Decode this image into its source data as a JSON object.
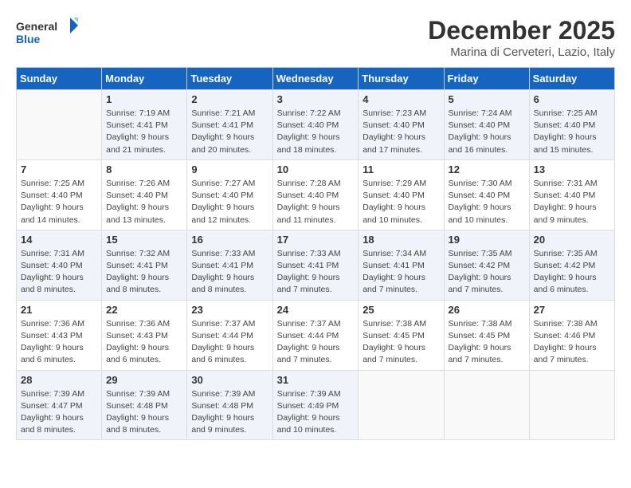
{
  "logo": {
    "text_general": "General",
    "text_blue": "Blue"
  },
  "title": {
    "month": "December 2025",
    "location": "Marina di Cerveteri, Lazio, Italy"
  },
  "days_of_week": [
    "Sunday",
    "Monday",
    "Tuesday",
    "Wednesday",
    "Thursday",
    "Friday",
    "Saturday"
  ],
  "weeks": [
    [
      {
        "day": "",
        "info": ""
      },
      {
        "day": "1",
        "info": "Sunrise: 7:19 AM\nSunset: 4:41 PM\nDaylight: 9 hours\nand 21 minutes."
      },
      {
        "day": "2",
        "info": "Sunrise: 7:21 AM\nSunset: 4:41 PM\nDaylight: 9 hours\nand 20 minutes."
      },
      {
        "day": "3",
        "info": "Sunrise: 7:22 AM\nSunset: 4:40 PM\nDaylight: 9 hours\nand 18 minutes."
      },
      {
        "day": "4",
        "info": "Sunrise: 7:23 AM\nSunset: 4:40 PM\nDaylight: 9 hours\nand 17 minutes."
      },
      {
        "day": "5",
        "info": "Sunrise: 7:24 AM\nSunset: 4:40 PM\nDaylight: 9 hours\nand 16 minutes."
      },
      {
        "day": "6",
        "info": "Sunrise: 7:25 AM\nSunset: 4:40 PM\nDaylight: 9 hours\nand 15 minutes."
      }
    ],
    [
      {
        "day": "7",
        "info": "Sunrise: 7:25 AM\nSunset: 4:40 PM\nDaylight: 9 hours\nand 14 minutes."
      },
      {
        "day": "8",
        "info": "Sunrise: 7:26 AM\nSunset: 4:40 PM\nDaylight: 9 hours\nand 13 minutes."
      },
      {
        "day": "9",
        "info": "Sunrise: 7:27 AM\nSunset: 4:40 PM\nDaylight: 9 hours\nand 12 minutes."
      },
      {
        "day": "10",
        "info": "Sunrise: 7:28 AM\nSunset: 4:40 PM\nDaylight: 9 hours\nand 11 minutes."
      },
      {
        "day": "11",
        "info": "Sunrise: 7:29 AM\nSunset: 4:40 PM\nDaylight: 9 hours\nand 10 minutes."
      },
      {
        "day": "12",
        "info": "Sunrise: 7:30 AM\nSunset: 4:40 PM\nDaylight: 9 hours\nand 10 minutes."
      },
      {
        "day": "13",
        "info": "Sunrise: 7:31 AM\nSunset: 4:40 PM\nDaylight: 9 hours\nand 9 minutes."
      }
    ],
    [
      {
        "day": "14",
        "info": "Sunrise: 7:31 AM\nSunset: 4:40 PM\nDaylight: 9 hours\nand 8 minutes."
      },
      {
        "day": "15",
        "info": "Sunrise: 7:32 AM\nSunset: 4:41 PM\nDaylight: 9 hours\nand 8 minutes."
      },
      {
        "day": "16",
        "info": "Sunrise: 7:33 AM\nSunset: 4:41 PM\nDaylight: 9 hours\nand 8 minutes."
      },
      {
        "day": "17",
        "info": "Sunrise: 7:33 AM\nSunset: 4:41 PM\nDaylight: 9 hours\nand 7 minutes."
      },
      {
        "day": "18",
        "info": "Sunrise: 7:34 AM\nSunset: 4:41 PM\nDaylight: 9 hours\nand 7 minutes."
      },
      {
        "day": "19",
        "info": "Sunrise: 7:35 AM\nSunset: 4:42 PM\nDaylight: 9 hours\nand 7 minutes."
      },
      {
        "day": "20",
        "info": "Sunrise: 7:35 AM\nSunset: 4:42 PM\nDaylight: 9 hours\nand 6 minutes."
      }
    ],
    [
      {
        "day": "21",
        "info": "Sunrise: 7:36 AM\nSunset: 4:43 PM\nDaylight: 9 hours\nand 6 minutes."
      },
      {
        "day": "22",
        "info": "Sunrise: 7:36 AM\nSunset: 4:43 PM\nDaylight: 9 hours\nand 6 minutes."
      },
      {
        "day": "23",
        "info": "Sunrise: 7:37 AM\nSunset: 4:44 PM\nDaylight: 9 hours\nand 6 minutes."
      },
      {
        "day": "24",
        "info": "Sunrise: 7:37 AM\nSunset: 4:44 PM\nDaylight: 9 hours\nand 7 minutes."
      },
      {
        "day": "25",
        "info": "Sunrise: 7:38 AM\nSunset: 4:45 PM\nDaylight: 9 hours\nand 7 minutes."
      },
      {
        "day": "26",
        "info": "Sunrise: 7:38 AM\nSunset: 4:45 PM\nDaylight: 9 hours\nand 7 minutes."
      },
      {
        "day": "27",
        "info": "Sunrise: 7:38 AM\nSunset: 4:46 PM\nDaylight: 9 hours\nand 7 minutes."
      }
    ],
    [
      {
        "day": "28",
        "info": "Sunrise: 7:39 AM\nSunset: 4:47 PM\nDaylight: 9 hours\nand 8 minutes."
      },
      {
        "day": "29",
        "info": "Sunrise: 7:39 AM\nSunset: 4:48 PM\nDaylight: 9 hours\nand 8 minutes."
      },
      {
        "day": "30",
        "info": "Sunrise: 7:39 AM\nSunset: 4:48 PM\nDaylight: 9 hours\nand 9 minutes."
      },
      {
        "day": "31",
        "info": "Sunrise: 7:39 AM\nSunset: 4:49 PM\nDaylight: 9 hours\nand 10 minutes."
      },
      {
        "day": "",
        "info": ""
      },
      {
        "day": "",
        "info": ""
      },
      {
        "day": "",
        "info": ""
      }
    ]
  ]
}
